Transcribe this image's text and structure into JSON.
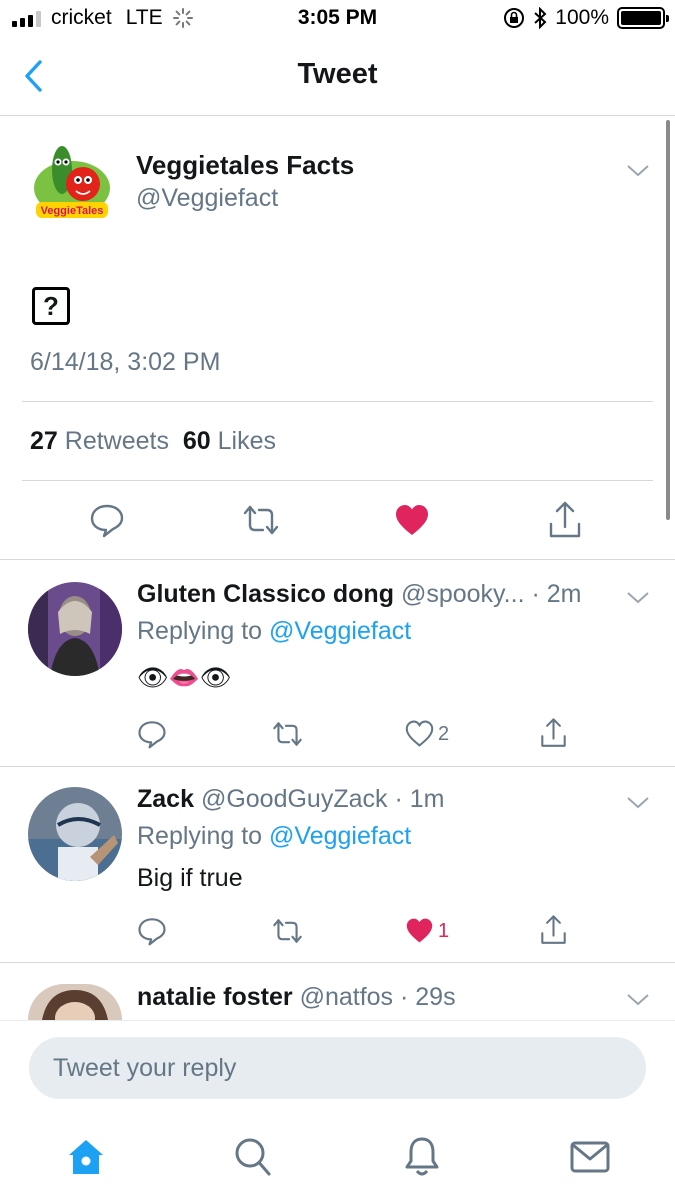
{
  "status_bar": {
    "carrier": "cricket",
    "network": "LTE",
    "time": "3:05 PM",
    "battery": "100%"
  },
  "nav": {
    "title": "Tweet",
    "back_icon": "chevron-left-icon"
  },
  "tweet": {
    "name": "Veggietales Facts",
    "handle": "@Veggiefact",
    "avatar_logo_text": "VeggieTales",
    "content_glyph": "?",
    "timestamp": "6/14/18, 3:02 PM",
    "retweets_count": "27",
    "retweets_label": "Retweets",
    "likes_count": "60",
    "likes_label": "Likes",
    "liked": true
  },
  "replies": [
    {
      "name": "Gluten Classico dong",
      "handle": "@spooky...",
      "time": "· 2m",
      "replying_prefix": "Replying to",
      "replying_to": "@Veggiefact",
      "text": "👁👄👁",
      "likes": "2",
      "liked": false
    },
    {
      "name": "Zack",
      "handle": "@GoodGuyZack",
      "time": "· 1m",
      "replying_prefix": "Replying to",
      "replying_to": "@Veggiefact",
      "text": "Big if true",
      "likes": "1",
      "liked": true
    },
    {
      "name": "natalie foster",
      "handle": "@natfos",
      "time": "· 29s"
    }
  ],
  "compose": {
    "placeholder": "Tweet your reply"
  },
  "tabs": [
    {
      "icon": "home-icon",
      "active": true
    },
    {
      "icon": "search-icon",
      "active": false
    },
    {
      "icon": "bell-icon",
      "active": false
    },
    {
      "icon": "mail-icon",
      "active": false
    }
  ],
  "colors": {
    "brand": "#1da1f2",
    "like": "#e0245e",
    "muted": "#657786",
    "divider": "#d6d9db"
  }
}
